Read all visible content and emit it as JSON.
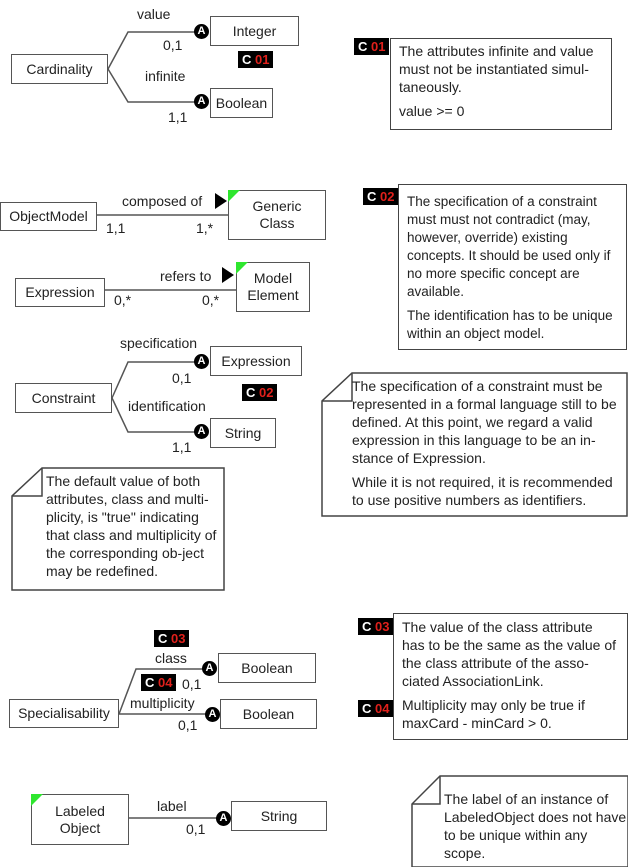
{
  "cardinality": {
    "class": "Cardinality",
    "attr1": "value",
    "mult1": "0,1",
    "type1": "Integer",
    "attr2": "infinite",
    "mult2": "1,1",
    "type2": "Boolean",
    "tag": {
      "c": "C",
      "n": "01"
    }
  },
  "note_c01": {
    "tag": {
      "c": "C",
      "n": "01"
    },
    "lines": [
      "The attributes infinite and value must not be instantiated simul-taneously.",
      "value >= 0"
    ]
  },
  "objectmodel": {
    "from": "ObjectModel",
    "relation": "composed of",
    "mult_from": "1,1",
    "mult_to": "1,*",
    "to": "Generic Class"
  },
  "note_c02": {
    "tag": {
      "c": "C",
      "n": "02"
    },
    "lines": [
      "The specification of a constraint must must not contradict (may, however, override) existing concepts. It should be used only if no more specific concept are available.",
      "The identification has to be unique within an object model."
    ]
  },
  "expression": {
    "from": "Expression",
    "relation": "refers to",
    "mult_from": "0,*",
    "mult_to": "0,*",
    "to": "Model Element"
  },
  "constraint": {
    "class": "Constraint",
    "attr1": "specification",
    "mult1": "0,1",
    "type1": "Expression",
    "attr2": "identification",
    "mult2": "1,1",
    "type2": "String",
    "tag": {
      "c": "C",
      "n": "02"
    }
  },
  "note_constraint": {
    "lines": [
      "The specification of a constraint must be represented in a formal language still to be defined. At this point, we regard a valid expression in this language to be an in-stance of Expression.",
      "While it is not required, it is recommended to use positive numbers as identifiers."
    ]
  },
  "note_default": {
    "lines": [
      "The default value of both attributes, class and multi-plicity, is \"true\" indicating that class and multiplicity of the corresponding ob-ject may be redefined."
    ]
  },
  "specialisability": {
    "class": "Specialisability",
    "attr1": "class",
    "mult1": "0,1",
    "type1": "Boolean",
    "attr2": "multiplicity",
    "mult2": "0,1",
    "type2": "Boolean",
    "tag1": {
      "c": "C",
      "n": "03"
    },
    "tag2": {
      "c": "C",
      "n": "04"
    }
  },
  "note_c03": {
    "tag1": {
      "c": "C",
      "n": "03"
    },
    "tag2": {
      "c": "C",
      "n": "04"
    },
    "line1": "The value of the class attribute has to be the same as the value of the class attribute of the asso-ciated AssociationLink.",
    "line2": "Multiplicity may only be true if maxCard - minCard > 0."
  },
  "labeled": {
    "class": "Labeled Object",
    "attr": "label",
    "mult": "0,1",
    "type": "String"
  },
  "note_label": {
    "lines": [
      "The label of an instance of LabeledObject does not have to be unique within any scope."
    ]
  },
  "badge_letter": "A",
  "colors": {
    "tag_number": "#e0201b",
    "abstract_corner": "#2ee62e"
  }
}
